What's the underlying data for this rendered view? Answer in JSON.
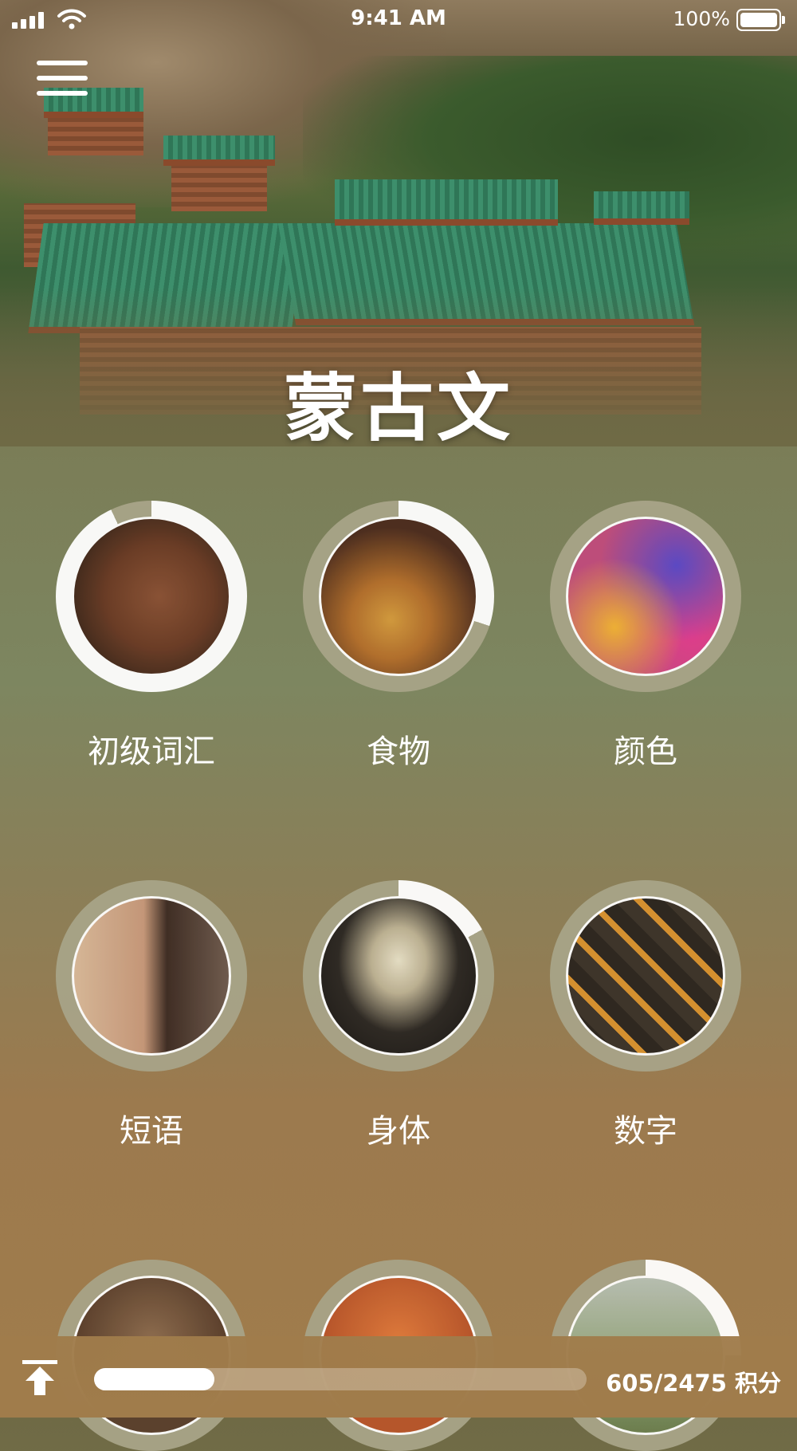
{
  "status_bar": {
    "time": "9:41 AM",
    "battery": "100%"
  },
  "header": {
    "title": "蒙古文"
  },
  "topics": [
    {
      "label": "初级词汇",
      "progress": 0.93,
      "image": "child-face"
    },
    {
      "label": "食物",
      "progress": 0.3,
      "image": "burger-and-soda"
    },
    {
      "label": "颜色",
      "progress": 0.0,
      "image": "color-powder"
    },
    {
      "label": "短语",
      "progress": 0.0,
      "image": "smiling-people"
    },
    {
      "label": "身体",
      "progress": 0.17,
      "image": "skeleton"
    },
    {
      "label": "数字",
      "progress": 0.0,
      "image": "wooden-numbers"
    },
    {
      "label": "",
      "progress": 0.0,
      "image": "headphones"
    },
    {
      "label": "",
      "progress": 0.0,
      "image": "orange-scene"
    },
    {
      "label": "",
      "progress": 0.25,
      "image": "field-flowers"
    }
  ],
  "footer": {
    "score_text": "605/2475 积分",
    "progress": 0.244
  },
  "colors": {
    "ring_track": "#a8a488",
    "ring_fill": "#ffffff"
  },
  "icons": [
    "signal-icon",
    "wifi-icon",
    "battery-icon",
    "menu-icon",
    "upload-icon"
  ]
}
